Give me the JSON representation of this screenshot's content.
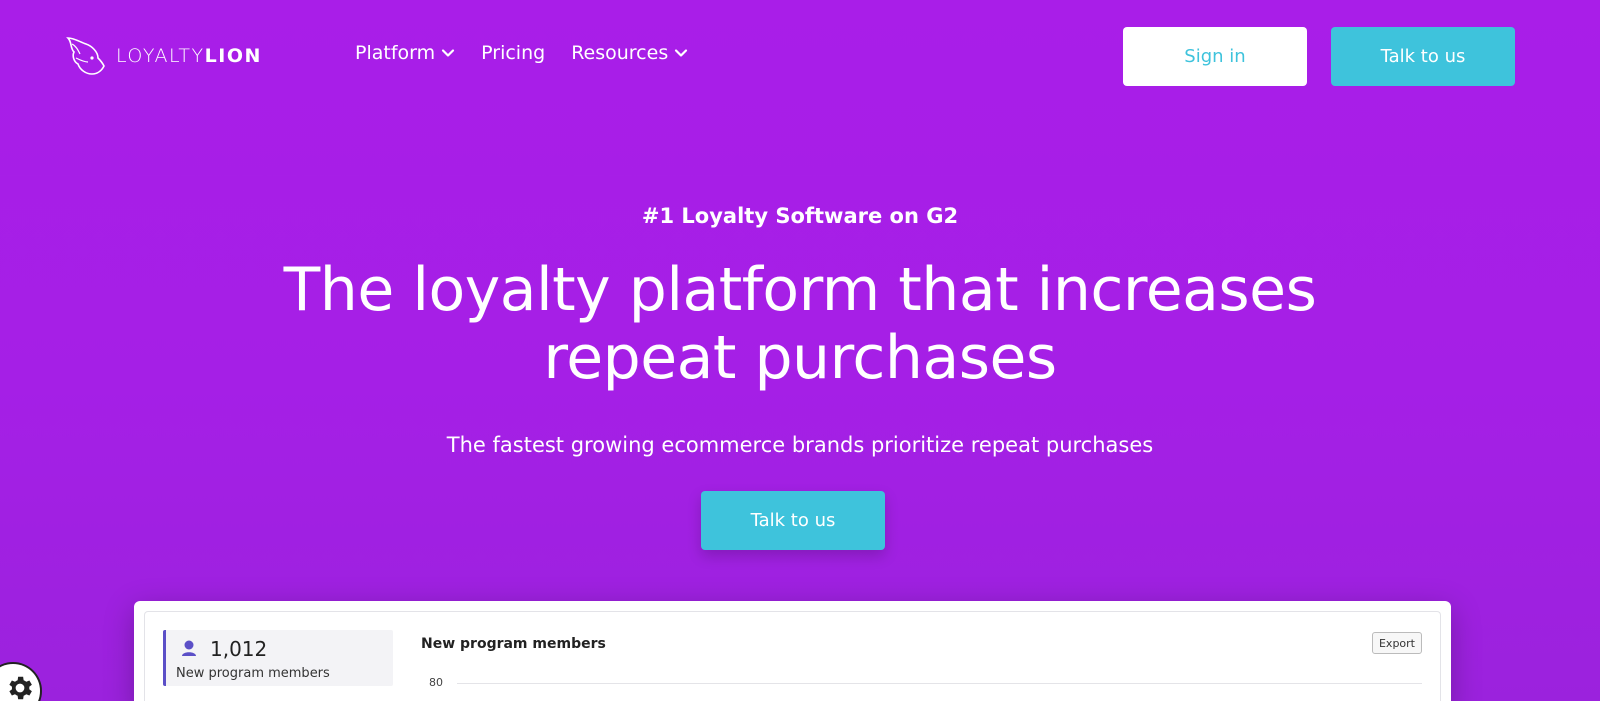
{
  "header": {
    "logo": {
      "text_light": "LOYALTY",
      "text_bold": "LION"
    },
    "nav": [
      {
        "label": "Platform",
        "has_dropdown": true,
        "icon": "chevron-down-icon"
      },
      {
        "label": "Pricing",
        "has_dropdown": false
      },
      {
        "label": "Resources",
        "has_dropdown": true,
        "icon": "chevron-down-icon"
      }
    ],
    "signin_label": "Sign in",
    "talk_label": "Talk to us"
  },
  "hero": {
    "eyebrow": "#1 Loyalty Software on G2",
    "headline_line1": "The loyalty platform that increases",
    "headline_line2": "repeat purchases",
    "subhead": "The fastest growing ecommerce brands prioritize repeat purchases",
    "cta_label": "Talk to us"
  },
  "dashboard": {
    "stat_value": "1,012",
    "stat_label": "New program members",
    "stat_icon": "user-icon",
    "chart_title": "New program members",
    "export_label": "Export",
    "y_tick_top": "80"
  },
  "cookie_settings_icon": "gear-icon",
  "colors": {
    "background": "#a91ee8",
    "accent": "#3ec3dc",
    "stat_border": "#5b4fc7"
  }
}
